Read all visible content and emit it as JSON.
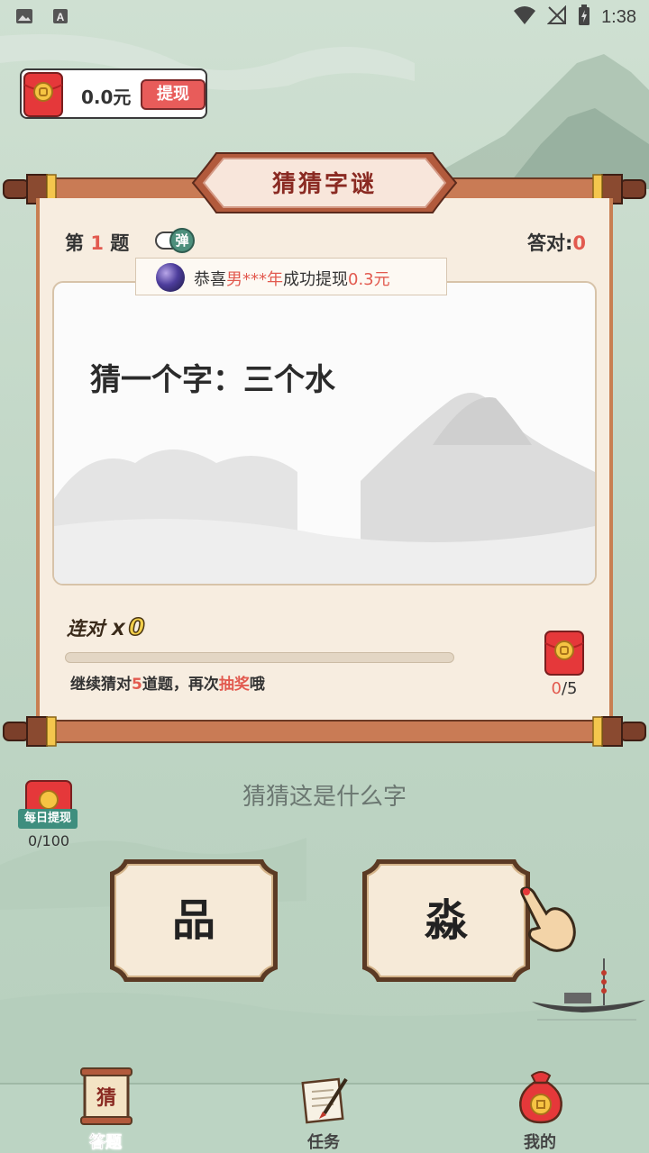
{
  "status_bar": {
    "time": "1:38",
    "left_icons": [
      "image-icon",
      "font-icon"
    ],
    "right_icons": [
      "wifi-icon",
      "signal-off-icon",
      "battery-charging-icon"
    ]
  },
  "wallet": {
    "amount": "0.0元",
    "withdraw_label": "提现"
  },
  "scroll": {
    "title": "猜猜字谜"
  },
  "question": {
    "prefix": "第",
    "number": "1",
    "suffix": "题",
    "toggle_label": "弹",
    "correct_prefix": "答对:",
    "correct_count": "0",
    "text": "猜一个字：三个水"
  },
  "notice": {
    "prefix": "恭喜",
    "user": "男***年",
    "middle": "成功提现",
    "amount": "0.3元"
  },
  "streak": {
    "label": "连对",
    "x": "X",
    "value": "0",
    "progress": 0
  },
  "hint": {
    "prefix": "继续猜对",
    "count": "5",
    "middle": "道题，再次",
    "highlight": "抽奖",
    "suffix": "哦"
  },
  "lottery": {
    "current": "0",
    "total": "/5"
  },
  "prompt": "猜猜这是什么字",
  "daily": {
    "tag": "每日提现",
    "count": "0/100"
  },
  "answers": [
    {
      "char": "品"
    },
    {
      "char": "淼"
    }
  ],
  "nav": [
    {
      "label": "答题",
      "icon_char": "猜",
      "active": true
    },
    {
      "label": "任务",
      "active": false
    },
    {
      "label": "我的",
      "active": false
    }
  ],
  "colors": {
    "accent_red": "#e85c5a",
    "scroll_wood": "#c87f52",
    "teal": "#3e8e7e",
    "background": "#c3d8c8"
  }
}
